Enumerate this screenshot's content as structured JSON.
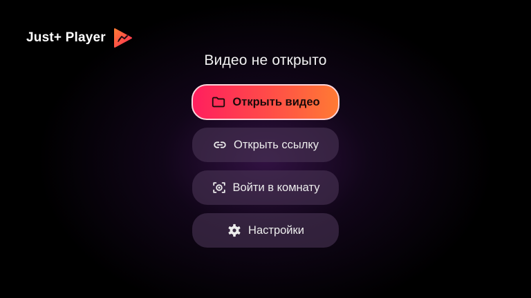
{
  "app": {
    "name": "Just+ Player",
    "logo_icon": "play-triangle-logo-icon",
    "colors": {
      "accent_start": "#ff1f5e",
      "accent_end": "#ff7a34",
      "background": "#000000"
    }
  },
  "status": {
    "title": "Видео не открыто"
  },
  "menu": {
    "open_video": {
      "label": "Открыть видео",
      "icon": "folder-icon"
    },
    "open_link": {
      "label": "Открыть ссылку",
      "icon": "link-icon"
    },
    "join_room": {
      "label": "Войти в комнату",
      "icon": "room-target-icon"
    },
    "settings": {
      "label": "Настройки",
      "icon": "gear-icon"
    }
  }
}
